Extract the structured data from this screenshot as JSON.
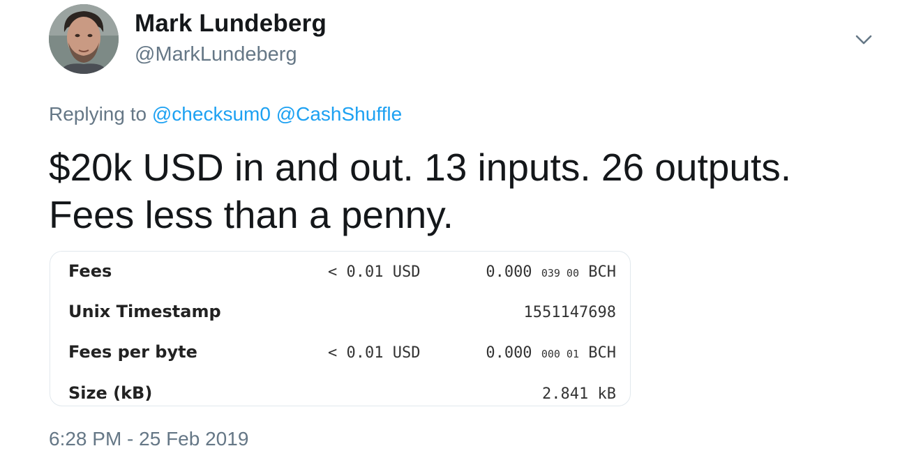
{
  "author": {
    "display_name": "Mark Lundeberg",
    "handle": "@MarkLundeberg"
  },
  "reply": {
    "prefix": "Replying to",
    "mentions": [
      "@checksum0",
      "@CashShuffle"
    ]
  },
  "tweet": {
    "line1": "$20k USD in and out. 13 inputs. 26 outputs.",
    "line2": "Fees less than a penny."
  },
  "table": {
    "rows": [
      {
        "label": "Fees",
        "usd": "< 0.01 USD",
        "bch_main": "0.000",
        "bch_small": "039 00",
        "bch_unit": "BCH"
      },
      {
        "label": "Unix Timestamp",
        "value": "1551147698"
      },
      {
        "label": "Fees per byte",
        "usd": "< 0.01 USD",
        "bch_main": "0.000",
        "bch_small": "000 01",
        "bch_unit": "BCH"
      },
      {
        "label": "Size (kB)",
        "value": "2.841 kB"
      }
    ]
  },
  "timestamp": "6:28 PM - 25 Feb 2019",
  "icons": [
    "avatar",
    "chevron-down-icon"
  ]
}
